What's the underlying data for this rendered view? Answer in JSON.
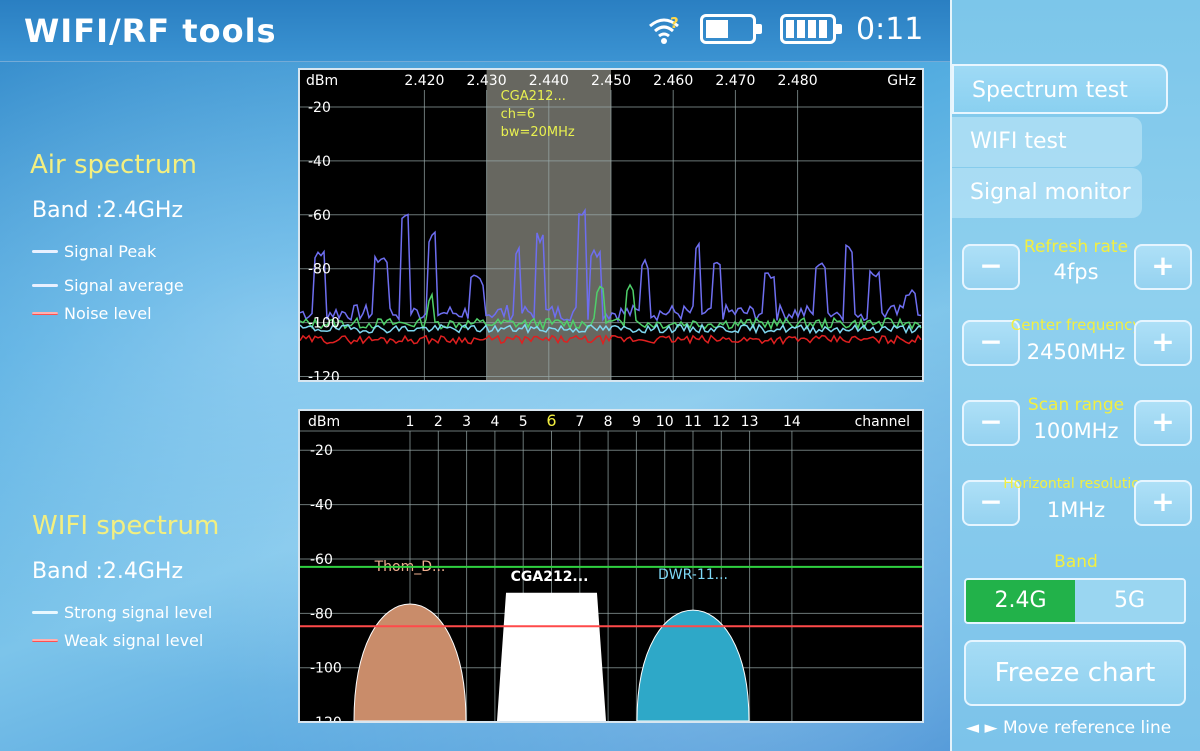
{
  "header": {
    "title": "WIFI/RF tools",
    "clock": "0:11",
    "icons": [
      "wifi-question-icon",
      "battery-icon",
      "battery-icon"
    ]
  },
  "air": {
    "title": "Air spectrum",
    "band": "Band :2.4GHz",
    "legend": [
      {
        "label": "Signal Peak",
        "color": "#ffffff"
      },
      {
        "label": "Signal average",
        "color": "#ffffff"
      },
      {
        "label": "Noise level",
        "color": "#ff6a6a"
      }
    ]
  },
  "wifi": {
    "title": "WIFI spectrum",
    "band": "Band :2.4GHz",
    "legend": [
      {
        "label": "Strong signal level",
        "color": "#ffffff"
      },
      {
        "label": "Weak signal level",
        "color": "#ff6a6a"
      }
    ]
  },
  "chart_data": [
    {
      "type": "line",
      "name": "air-spectrum",
      "xlabel_unit": "GHz",
      "ylabel_unit": "dBm",
      "x_ticks": [
        "2.420",
        "2.430",
        "2.440",
        "2.450",
        "2.460",
        "2.470",
        "2.480"
      ],
      "y_ticks": [
        "-20",
        "-40",
        "-60",
        "-80",
        "-100",
        "-120"
      ],
      "xlim": [
        2.4,
        2.5
      ],
      "ylim": [
        -125,
        -10
      ],
      "highlight": {
        "range": [
          2.43,
          2.45
        ],
        "labels": [
          "CGA212...",
          "ch=6",
          "bw=20MHz"
        ]
      },
      "grid": true
    },
    {
      "type": "area",
      "name": "wifi-spectrum",
      "xlabel_unit": "channel",
      "ylabel_unit": "dBm",
      "x_ticks": [
        "1",
        "2",
        "3",
        "4",
        "5",
        "6",
        "7",
        "8",
        "9",
        "10",
        "11",
        "12",
        "13",
        "14"
      ],
      "selected_channel": "6",
      "y_ticks": [
        "-20",
        "-40",
        "-60",
        "-80",
        "-100",
        "-120"
      ],
      "ylim": [
        -124,
        -10
      ],
      "strong_level": -64,
      "weak_level": -84,
      "networks": [
        {
          "name": "Thom_D...",
          "channel": 1,
          "level": -74,
          "color": "#c98c6a"
        },
        {
          "name": "CGA212...",
          "channel": 6,
          "level": -77,
          "color": "#ffffff"
        },
        {
          "name": "DWR-11...",
          "channel": 11,
          "level": -77,
          "color": "#2ea8c8"
        }
      ],
      "grid": true
    }
  ],
  "side": {
    "tabs": [
      {
        "label": "Spectrum test",
        "active": true
      },
      {
        "label": "WIFI test",
        "active": false
      },
      {
        "label": "Signal monitor",
        "active": false
      }
    ],
    "controls": [
      {
        "label": "Refresh rate",
        "value": "4fps"
      },
      {
        "label": "Center frequency",
        "value": "2450MHz"
      },
      {
        "label": "Scan range",
        "value": "100MHz"
      },
      {
        "label": "Horizontal resolution",
        "value": "1MHz"
      }
    ],
    "minus": "−",
    "plus": "+",
    "band_title": "Band",
    "band_options": [
      "2.4G",
      "5G"
    ],
    "freeze": "Freeze chart",
    "move_ref": "◄ ► Move reference line"
  }
}
